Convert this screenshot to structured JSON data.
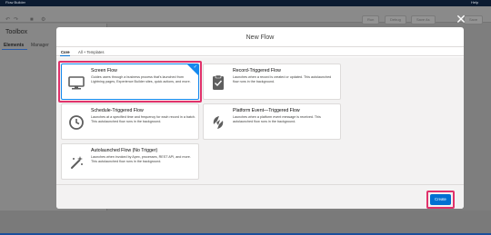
{
  "app": {
    "top_left": "Flow Builder",
    "top_right": "Help",
    "toolbar_buttons": [
      "Run",
      "Debug",
      "Save As",
      "Save"
    ],
    "sidebar_title": "Toolbox",
    "sidebar_tabs": [
      "Elements",
      "Manager"
    ]
  },
  "modal": {
    "title": "New Flow",
    "tabs": {
      "core": "Core",
      "all": "All + Templates"
    },
    "cards": [
      {
        "title": "Screen Flow",
        "desc": "Guides users through a business process that's launched from Lightning pages, Experience Builder sites, quick actions, and more.",
        "selected": true,
        "icon": "monitor-icon"
      },
      {
        "title": "Record-Triggered Flow",
        "desc": "Launches when a record is created or updated. This autolaunched flow runs in the background.",
        "selected": false,
        "icon": "clipboard-icon"
      },
      {
        "title": "Schedule-Triggered Flow",
        "desc": "Launches at a specified time and frequency for each record in a batch. This autolaunched flow runs in the background.",
        "selected": false,
        "icon": "clock-icon"
      },
      {
        "title": "Platform Event—Triggered Flow",
        "desc": "Launches when a platform event message is received. This autolaunched flow runs in the background.",
        "selected": false,
        "icon": "platform-event-icon"
      },
      {
        "title": "Autolaunched Flow (No Trigger)",
        "desc": "Launches when invoked by Apex, processes, REST API, and more. This autolaunched flow runs in the background.",
        "selected": false,
        "icon": "magic-wand-icon"
      }
    ],
    "create_label": "Create"
  },
  "colors": {
    "accent": "#0070d2",
    "selected_border": "#1589ee",
    "highlight": "#e0326b",
    "icon_bg": "#5e5e5e"
  }
}
